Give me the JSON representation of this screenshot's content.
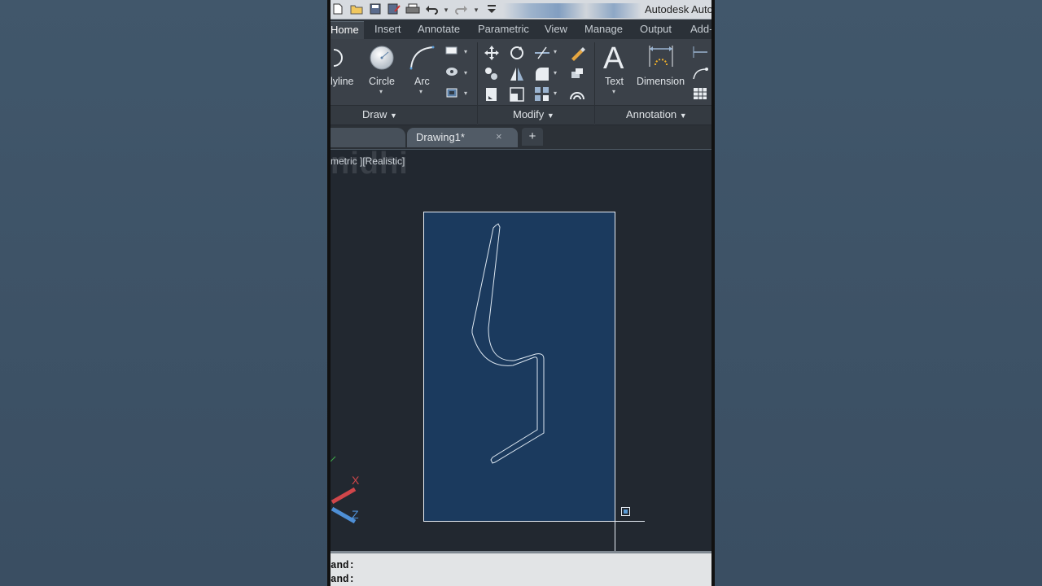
{
  "title_bar": {
    "app_title": "Autodesk Auto"
  },
  "quick_access": {
    "icons": [
      "new-file-icon",
      "open-folder-icon",
      "save-icon",
      "save-as-icon",
      "print-icon",
      "undo-icon",
      "redo-icon",
      "customize-dropdown-icon"
    ]
  },
  "ribbon_tabs": [
    {
      "label": "Home",
      "active": true
    },
    {
      "label": "Insert"
    },
    {
      "label": "Annotate"
    },
    {
      "label": "Parametric"
    },
    {
      "label": "View"
    },
    {
      "label": "Manage"
    },
    {
      "label": "Output"
    },
    {
      "label": "Add-"
    }
  ],
  "ribbon": {
    "draw": {
      "polyline_label": "lyline",
      "circle_label": "Circle",
      "arc_label": "Arc",
      "panel_title": "Draw"
    },
    "modify": {
      "panel_title": "Modify"
    },
    "annotation": {
      "text_label": "Text",
      "dimension_label": "Dimension",
      "panel_title": "Annotation"
    }
  },
  "document_tabs": {
    "active_label": "Drawing1*",
    "new_tab_symbol": "+",
    "close_symbol": "×"
  },
  "viewport": {
    "label": "metric ][Realistic]",
    "watermark": "nidhi"
  },
  "ucs": {
    "x_label": "X",
    "z_label": "Z"
  },
  "command_line": {
    "lines": [
      "and:",
      "and:"
    ]
  },
  "colors": {
    "canvas_bg": "#222830",
    "rect_fill": "#1b3a5e",
    "rect_stroke": "#e8eef5",
    "ribbon_bg": "#3b4149",
    "page_bg": "#3d5164"
  }
}
